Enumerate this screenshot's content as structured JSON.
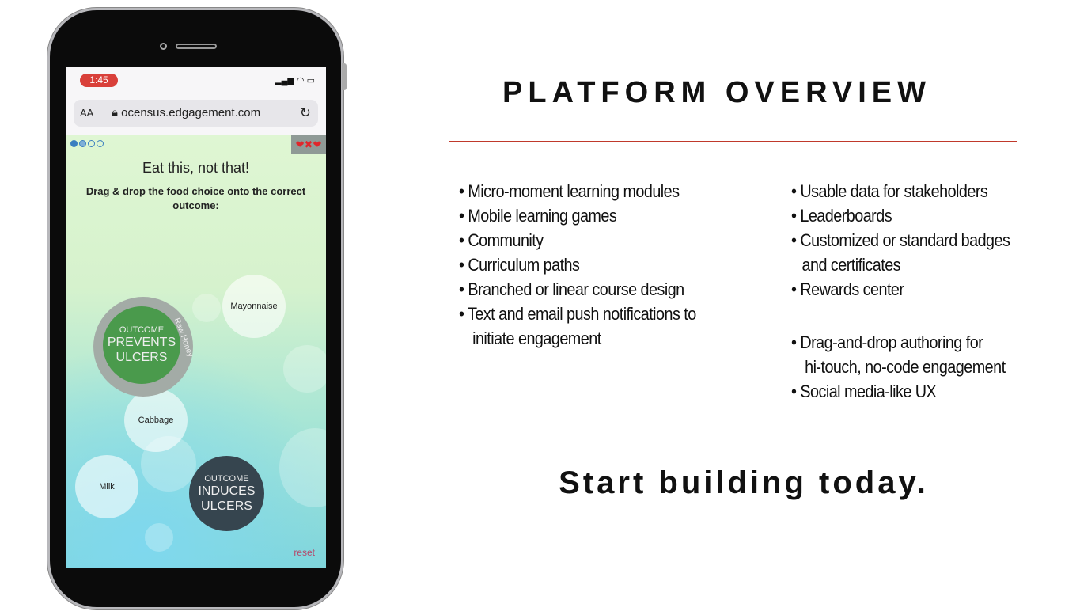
{
  "phone": {
    "status_time": "1:45",
    "browser": {
      "text_size_label": "AA",
      "url": "ocensus.edgagement.com",
      "lock_icon": "lock-icon",
      "reload_icon": "reload-icon"
    },
    "game": {
      "progress_dots": {
        "total": 4,
        "filled": 2
      },
      "lives_icon": "hearts-icon",
      "title": "Eat this, not that!",
      "instruction": "Drag & drop the food choice onto the correct outcome:",
      "outcomes": [
        {
          "small": "OUTCOME",
          "line1": "PREVENTS",
          "line2": "ULCERS",
          "color": "#4a9a4c",
          "ring_label": "Raw Honey"
        },
        {
          "small": "OUTCOME",
          "line1": "INDUCES",
          "line2": "ULCERS",
          "color": "#36454f"
        }
      ],
      "foods": [
        "Mayonnaise",
        "Cabbage",
        "Milk"
      ],
      "reset_label": "reset"
    }
  },
  "slide": {
    "title": "PLATFORM OVERVIEW",
    "accent": "#c0392b",
    "left_list": [
      "• Micro-moment learning modules",
      "• Mobile learning games",
      "• Community",
      "• Curriculum paths",
      "• Branched or linear course design",
      "• Text and email push notifications to",
      "initiate engagement"
    ],
    "right_list": [
      "• Usable data for stakeholders",
      "• Leaderboards",
      "• Customized or standard badges",
      "and certificates",
      "• Rewards center",
      "• Drag-and-drop authoring for",
      "hi-touch, no-code engagement",
      "• Social media-like UX"
    ],
    "cta": "Start building today."
  }
}
